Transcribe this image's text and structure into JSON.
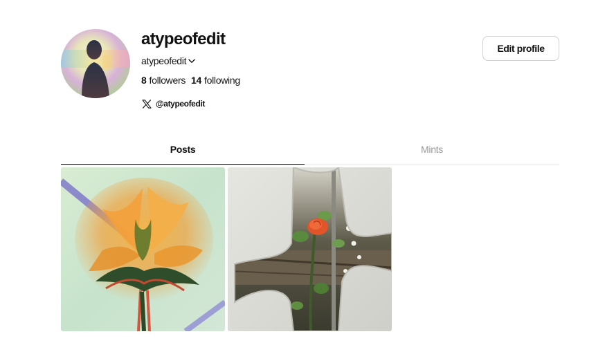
{
  "profile": {
    "display_name": "atypeofedit",
    "username": "atypeofedit",
    "followers_count": "8",
    "followers_label": "followers",
    "following_count": "14",
    "following_label": "following",
    "social_handle": "@atypeofedit",
    "social_icon": "x-logo-icon",
    "avatar_icon": "profile-avatar"
  },
  "actions": {
    "edit_profile_label": "Edit profile"
  },
  "tabs": [
    {
      "label": "Posts",
      "active": true
    },
    {
      "label": "Mints",
      "active": false
    }
  ],
  "posts": [
    {
      "subject": "sunflower-image"
    },
    {
      "subject": "rose-through-cross-image"
    }
  ],
  "colors": {
    "text_primary": "#111111",
    "text_muted": "#999999",
    "border": "#cfcfcf",
    "divider": "#e3e3e3"
  }
}
